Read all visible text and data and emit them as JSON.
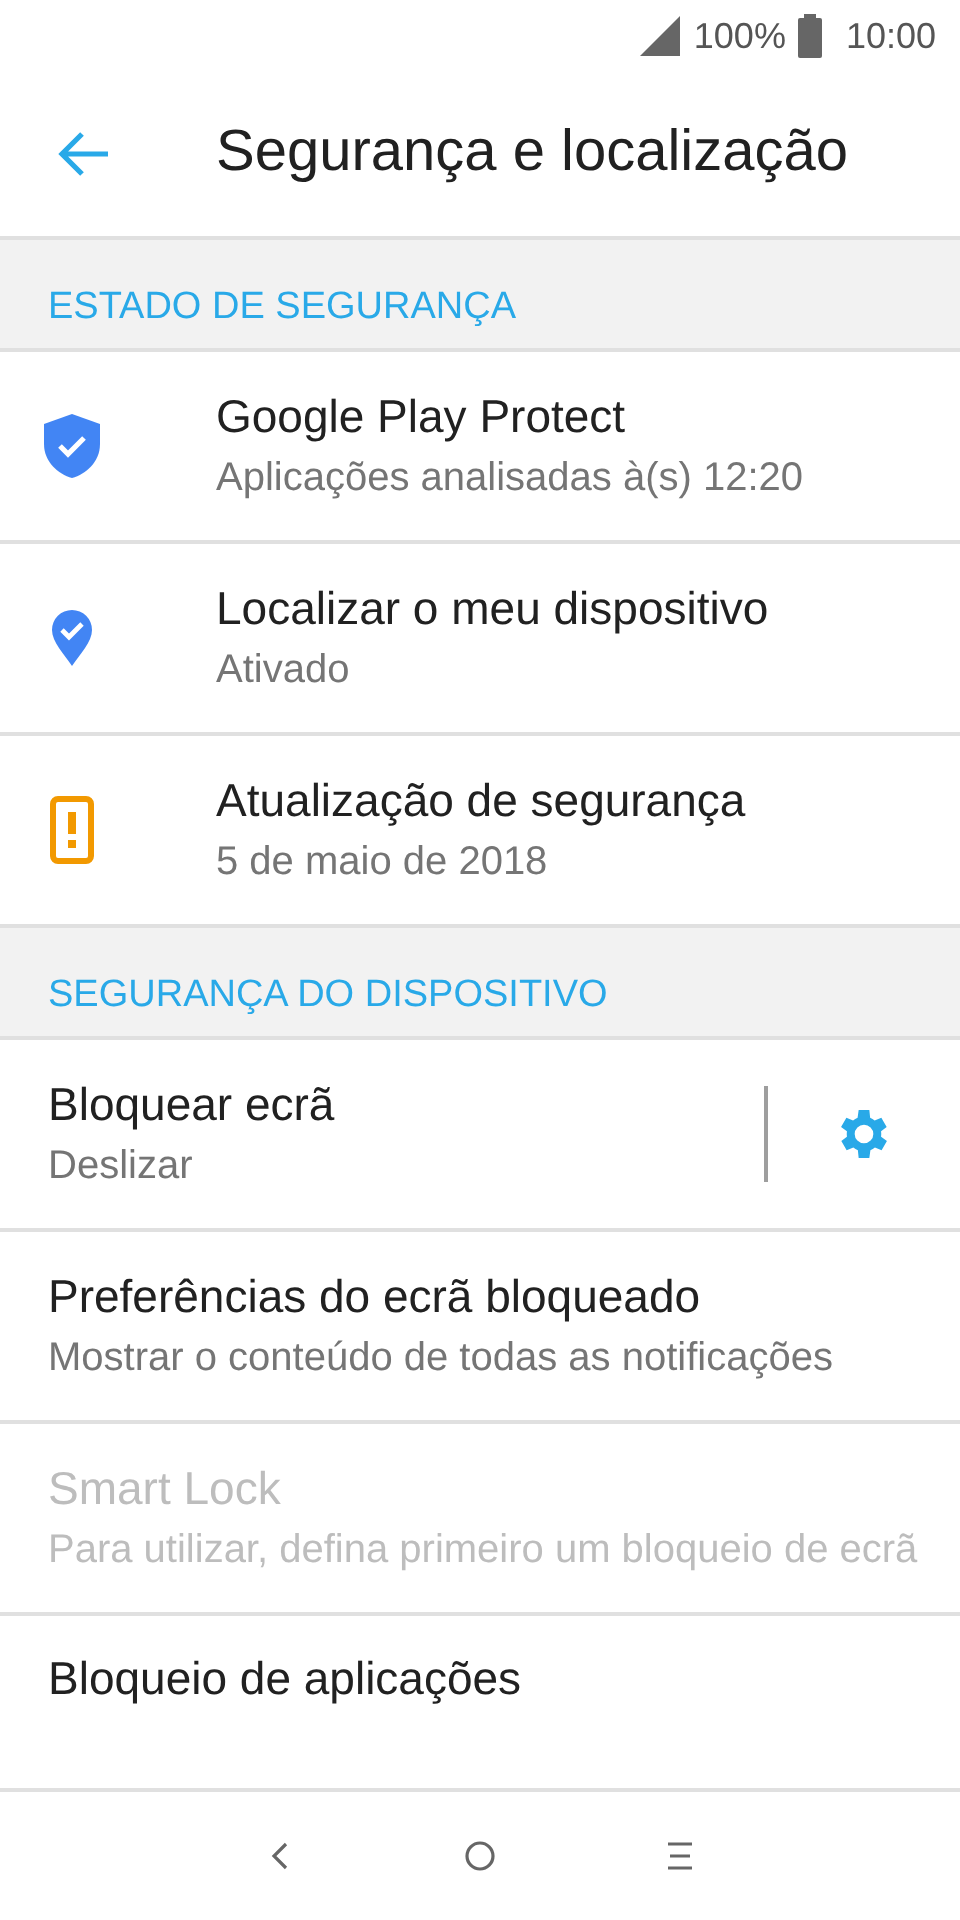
{
  "status_bar": {
    "battery": "100%",
    "time": "10:00"
  },
  "header": {
    "title": "Segurança e localização"
  },
  "sections": [
    {
      "title": "ESTADO DE SEGURANÇA",
      "items": [
        {
          "kind": "status",
          "title": "Google Play Protect",
          "subtitle": "Aplicações analisadas à(s) 12:20",
          "disabled": false
        },
        {
          "kind": "status",
          "title": "Localizar o meu dispositivo",
          "subtitle": "Ativado",
          "disabled": false
        },
        {
          "kind": "status",
          "title": "Atualização de segurança",
          "subtitle": "5 de maio de 2018",
          "disabled": false
        }
      ]
    },
    {
      "title": "SEGURANÇA DO DISPOSITIVO",
      "items": [
        {
          "kind": "settings",
          "title": "Bloquear ecrã",
          "subtitle": "Deslizar",
          "disabled": false
        },
        {
          "kind": "plain",
          "title": "Preferências do ecrã bloqueado",
          "subtitle": "Mostrar o conteúdo de todas as notificações",
          "disabled": false
        },
        {
          "kind": "plain",
          "title": "Smart Lock",
          "subtitle": "Para utilizar, defina primeiro um bloqueio de ecrã",
          "disabled": true
        },
        {
          "kind": "plain",
          "title": "Bloqueio de aplicações",
          "disabled": false
        }
      ]
    }
  ]
}
